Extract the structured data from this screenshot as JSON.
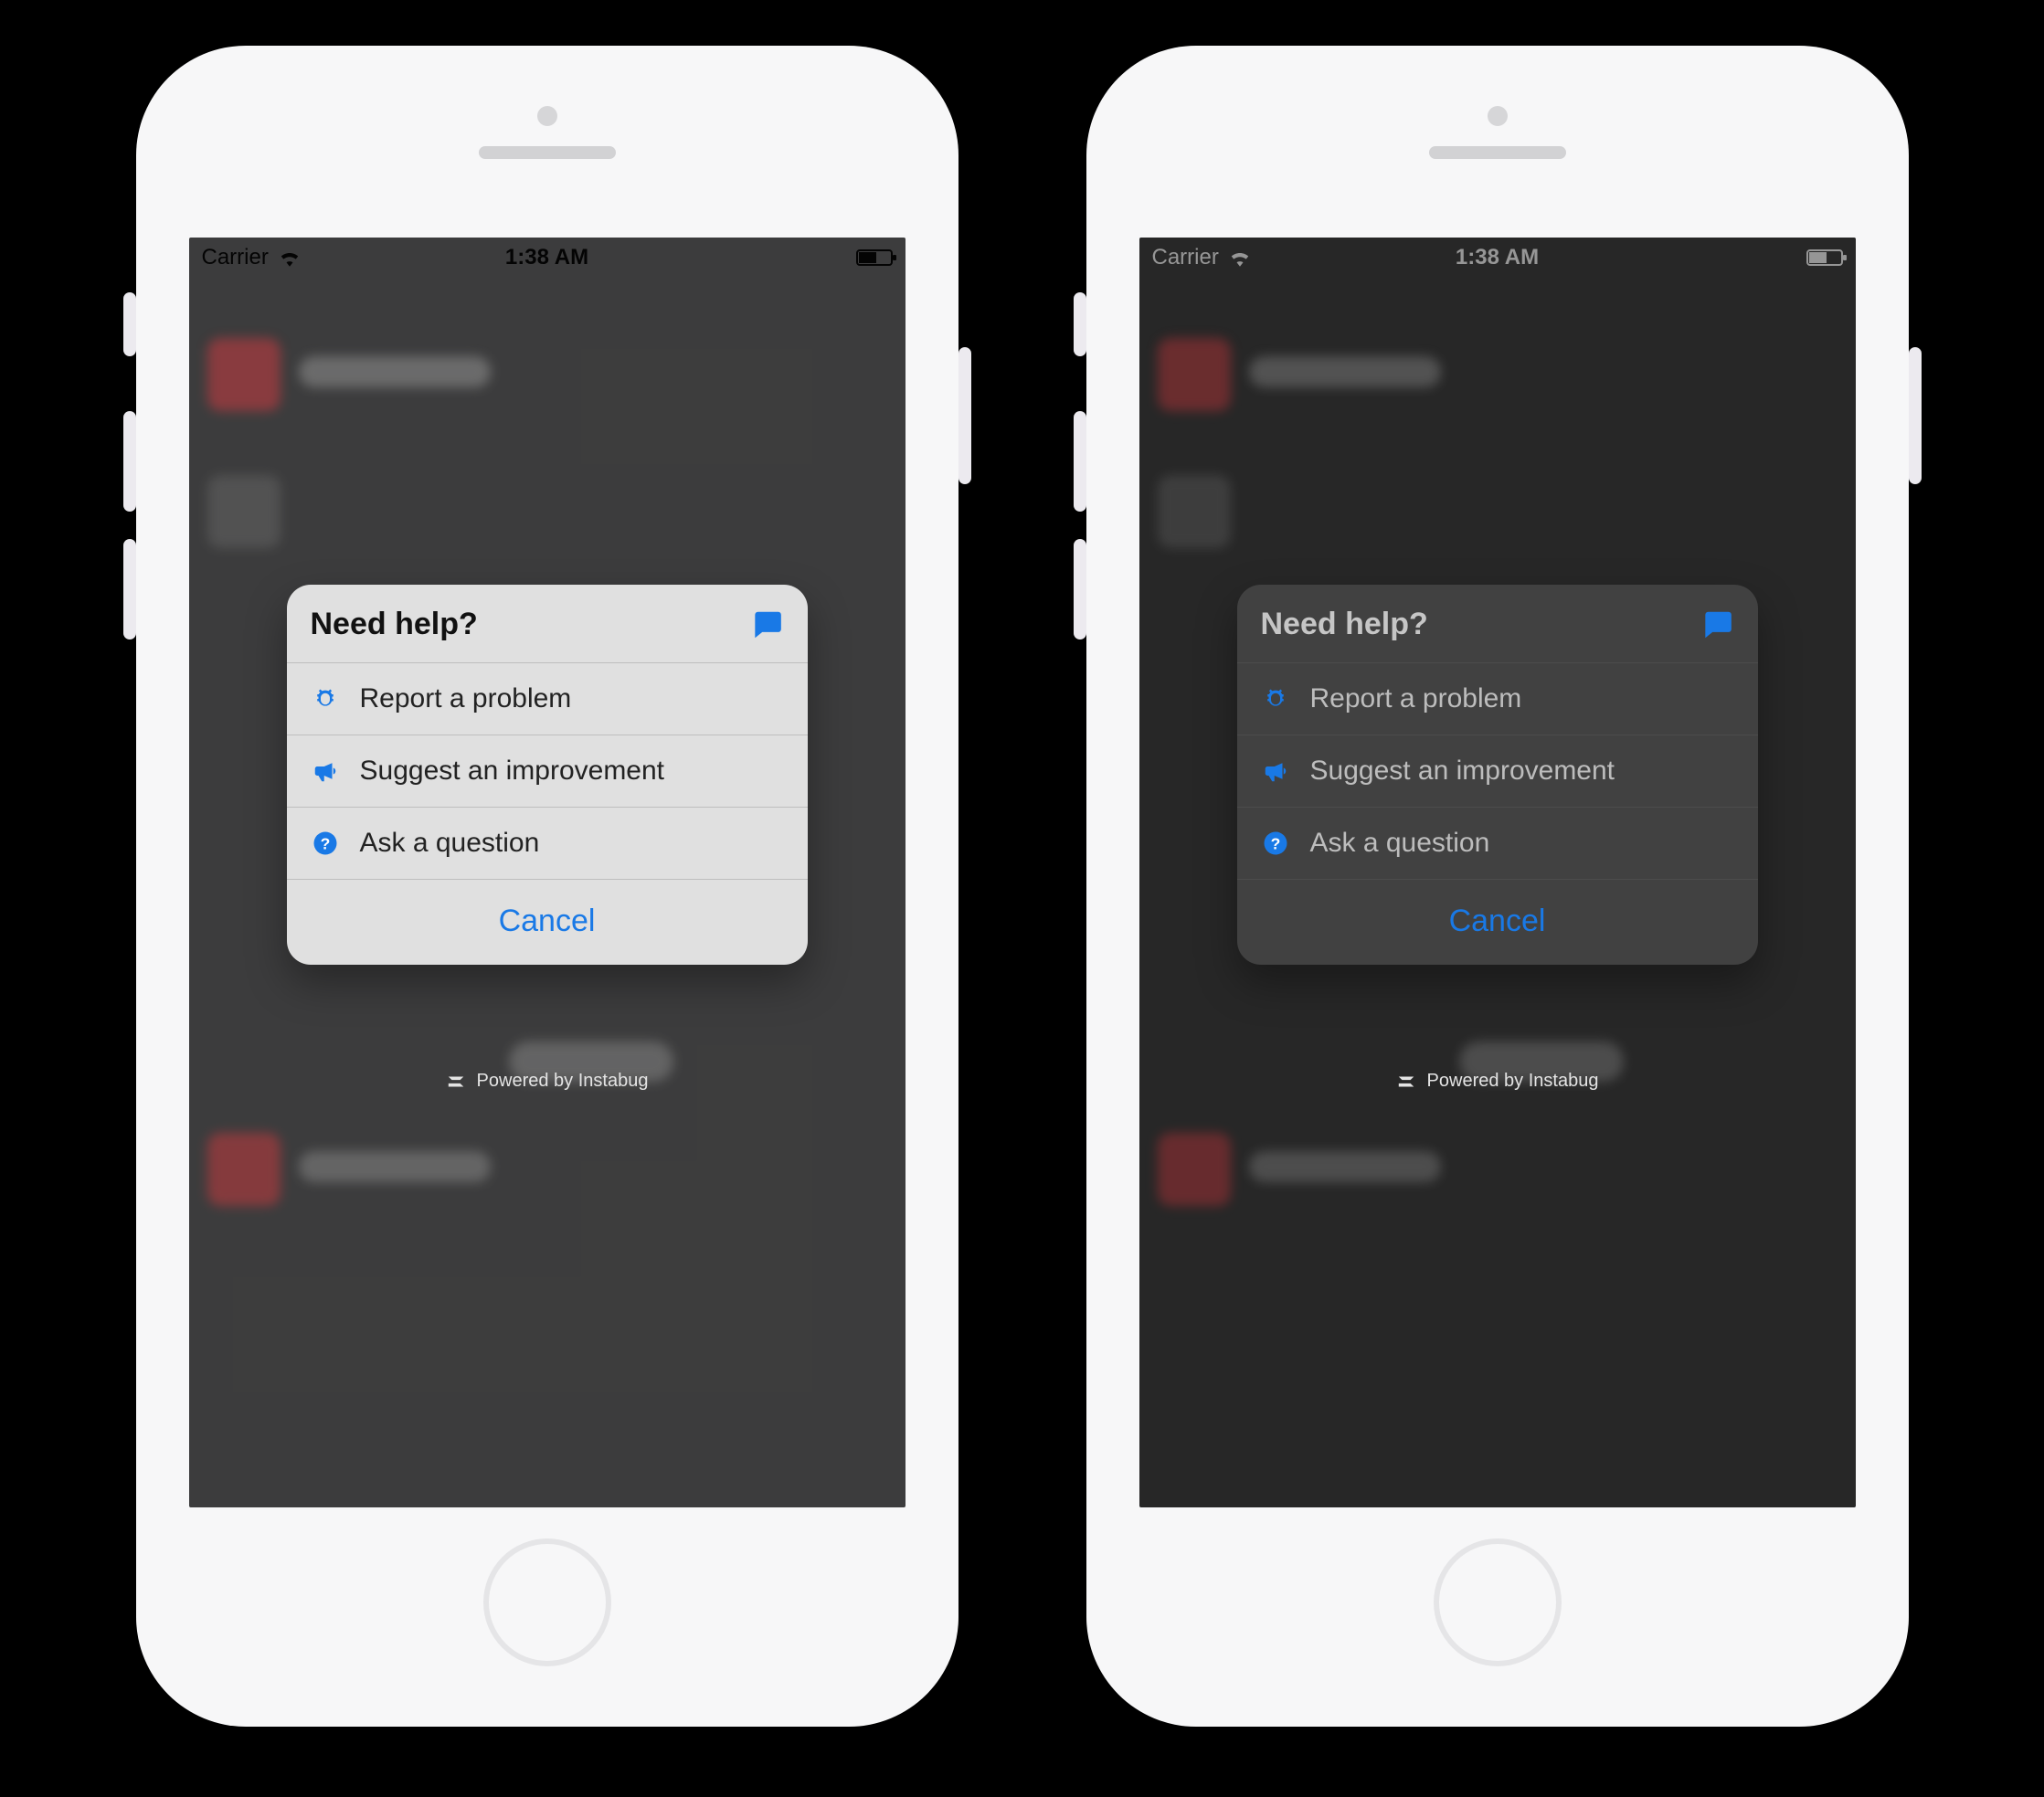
{
  "status_bar": {
    "carrier": "Carrier",
    "time": "1:38 AM"
  },
  "sheet": {
    "title": "Need help?",
    "options": [
      {
        "icon": "bug-icon",
        "label": "Report a problem"
      },
      {
        "icon": "megaphone-icon",
        "label": "Suggest an improvement"
      },
      {
        "icon": "question-icon",
        "label": "Ask a question"
      }
    ],
    "cancel": "Cancel"
  },
  "footer": {
    "powered_by": "Powered by Instabug"
  },
  "colors": {
    "accent": "#1979e6"
  }
}
